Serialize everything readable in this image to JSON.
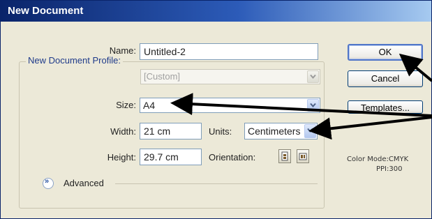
{
  "window": {
    "title": "New Document"
  },
  "form": {
    "name_label": "Name:",
    "name_value": "Untitled-2",
    "profile_label": "New Document Profile:",
    "profile_value": "[Custom]",
    "size_label": "Size:",
    "size_value": "A4",
    "width_label": "Width:",
    "width_value": "21 cm",
    "units_label": "Units:",
    "units_value": "Centimeters",
    "height_label": "Height:",
    "height_value": "29.7 cm",
    "orientation_label": "Orientation:",
    "advanced_label": "Advanced"
  },
  "buttons": {
    "ok": "OK",
    "cancel": "Cancel",
    "templates": "Templates..."
  },
  "info": {
    "color_mode": "Color Mode:CMYK",
    "ppi": "PPI:300"
  },
  "icons": {
    "profile_dropdown": "chevron-down-icon",
    "size_dropdown": "chevron-down-icon",
    "units_dropdown": "chevron-down-icon",
    "advanced_toggle": "double-chevron-down-icon",
    "portrait": "portrait-orientation-icon",
    "landscape": "landscape-orientation-icon"
  },
  "annotations": {
    "arrow_color": "#000000",
    "count": 3
  }
}
